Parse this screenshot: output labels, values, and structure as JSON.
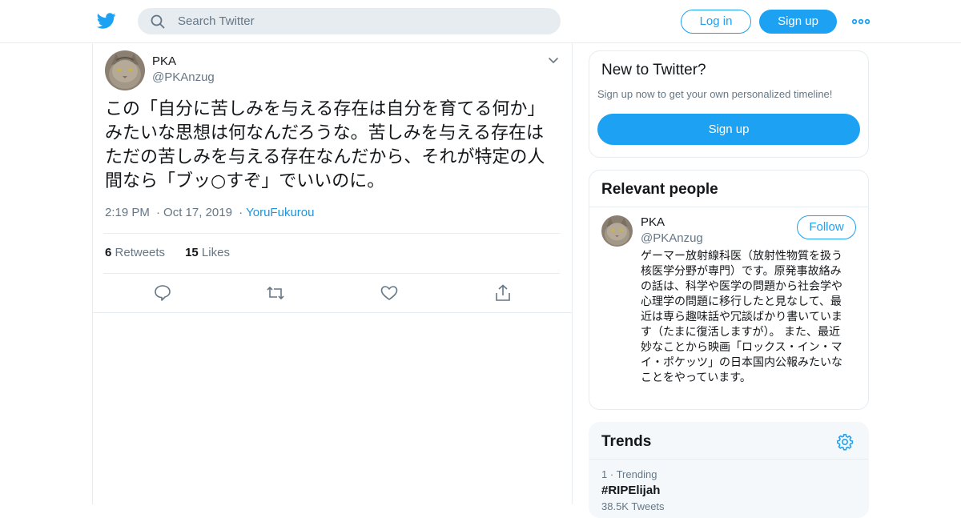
{
  "header": {
    "logo_icon": "twitter-bird-icon",
    "search": {
      "placeholder": "Search Twitter",
      "value": ""
    },
    "login_label": "Log in",
    "signup_label": "Sign up",
    "more_icon": "more-dots-icon"
  },
  "tweet": {
    "author_name": "PKA",
    "author_handle": "@PKAnzug",
    "text": "この「自分に苦しみを与える存在は自分を育てる何か」みたいな思想は何なんだろうな。苦しみを与える存在はただの苦しみを与える存在なんだから、それが特定の人間なら「ブッ○すぞ」でいいのに。",
    "time": "2:19 PM",
    "date": "Oct 17, 2019",
    "meta_sep": "·",
    "source": "YoruFukurou",
    "retweets_count": "6",
    "retweets_label": "Retweets",
    "likes_count": "15",
    "likes_label": "Likes",
    "actions": [
      "reply-icon",
      "retweet-icon",
      "like-icon",
      "share-icon"
    ]
  },
  "new_to_twitter": {
    "title": "New to Twitter?",
    "subtitle": "Sign up now to get your own personalized timeline!",
    "signup_label": "Sign up"
  },
  "relevant_people": {
    "title": "Relevant people",
    "person": {
      "name": "PKA",
      "handle": "@PKAnzug",
      "follow_label": "Follow",
      "bio": "ゲーマー放射線科医（放射性物質を扱う核医学分野が専門）です。原発事故絡みの話は、科学や医学の問題から社会学や心理学の問題に移行したと見なして、最近は専ら趣味話や冗談ばかり書いています（たまに復活しますが）。 また、最近妙なことから映画「ロックス・イン・マイ・ポケッツ」の日本国内公報みたいなことをやっています。"
    }
  },
  "trends": {
    "title": "Trends",
    "settings_icon": "gear-icon",
    "items": [
      {
        "rank": "1",
        "sep": "·",
        "label": "Trending",
        "tag": "#RIPElijah",
        "count": "38.5K Tweets"
      }
    ]
  },
  "colors": {
    "accent": "#1da1f2",
    "link": "#1b95e0",
    "muted": "#657786",
    "border": "#e6ecf0"
  }
}
